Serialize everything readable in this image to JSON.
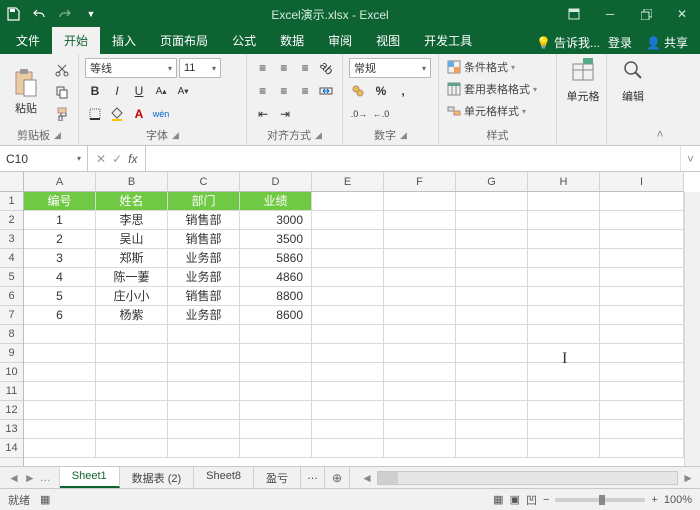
{
  "titlebar": {
    "title": "Excel演示.xlsx - Excel"
  },
  "tabs": {
    "file": "文件",
    "home": "开始",
    "insert": "插入",
    "layout": "页面布局",
    "formula": "公式",
    "data": "数据",
    "review": "审阅",
    "view": "视图",
    "dev": "开发工具",
    "tell": "告诉我...",
    "signin": "登录",
    "share": "共享"
  },
  "ribbon": {
    "clipboard": {
      "paste": "粘贴",
      "label": "剪贴板"
    },
    "font": {
      "name": "等线",
      "size": "11",
      "label": "字体"
    },
    "align": {
      "label": "对齐方式"
    },
    "number": {
      "format": "常规",
      "label": "数字"
    },
    "styles": {
      "cond": "条件格式",
      "table": "套用表格格式",
      "cell": "单元格样式",
      "label": "样式"
    },
    "cells": {
      "label": "单元格"
    },
    "edit": {
      "label": "编辑"
    }
  },
  "formula_bar": {
    "namebox": "C10",
    "value": ""
  },
  "grid": {
    "cols": [
      "A",
      "B",
      "C",
      "D",
      "E",
      "F",
      "G",
      "H",
      "I"
    ],
    "rows": [
      1,
      2,
      3,
      4,
      5,
      6,
      7,
      8,
      9,
      10,
      11,
      12,
      13,
      14
    ],
    "headers": [
      "编号",
      "姓名",
      "部门",
      "业绩"
    ],
    "data": [
      [
        "1",
        "李思",
        "销售部",
        "3000"
      ],
      [
        "2",
        "吴山",
        "销售部",
        "3500"
      ],
      [
        "3",
        "郑斯",
        "业务部",
        "5860"
      ],
      [
        "4",
        "陈一萋",
        "业务部",
        "4860"
      ],
      [
        "5",
        "庄小小",
        "销售部",
        "8800"
      ],
      [
        "6",
        "杨紫",
        "业务部",
        "8600"
      ]
    ]
  },
  "sheets": {
    "s1": "Sheet1",
    "s2": "数据表 (2)",
    "s3": "Sheet8",
    "s4": "盈亏"
  },
  "status": {
    "ready": "就绪",
    "zoom": "100%"
  }
}
